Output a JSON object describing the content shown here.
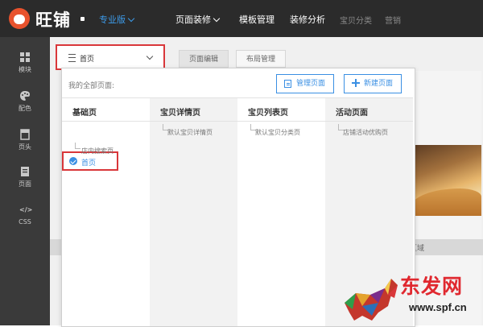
{
  "brand": {
    "name": "旺铺",
    "edition": "专业版"
  },
  "topnav": [
    {
      "label": "页面装修",
      "has_dropdown": true
    },
    {
      "label": "模板管理"
    },
    {
      "label": "装修分析"
    },
    {
      "label": "宝贝分类"
    },
    {
      "label": "营销"
    }
  ],
  "sidebar": [
    {
      "label": "模块",
      "icon": "grid-icon"
    },
    {
      "label": "配色",
      "icon": "palette-icon"
    },
    {
      "label": "页头",
      "icon": "page-header-icon"
    },
    {
      "label": "页面",
      "icon": "page-icon"
    },
    {
      "label": "CSS",
      "icon": "code-icon",
      "glyph": "</>"
    }
  ],
  "page_selector": {
    "value": "首页"
  },
  "tabs": [
    {
      "label": "页面编辑",
      "active": true
    },
    {
      "label": "布局管理",
      "active": false
    }
  ],
  "panel": {
    "title": "我的全部页面:",
    "manage_button": "管理页面",
    "new_button": "新建页面",
    "columns": [
      {
        "header": "基础页",
        "items": [
          "首页",
          "店内搜索页"
        ]
      },
      {
        "header": "宝贝详情页",
        "items": [
          "默认宝贝详情页"
        ]
      },
      {
        "header": "宝贝列表页",
        "items": [
          "默认宝贝分类页"
        ]
      },
      {
        "header": "活动页面",
        "items": [
          "店铺活动优购页"
        ]
      }
    ],
    "selected_page": "首页"
  },
  "canvas": {
    "band_text": "区域"
  },
  "watermark": {
    "text": "东发网",
    "url": "www.spf.cn"
  }
}
